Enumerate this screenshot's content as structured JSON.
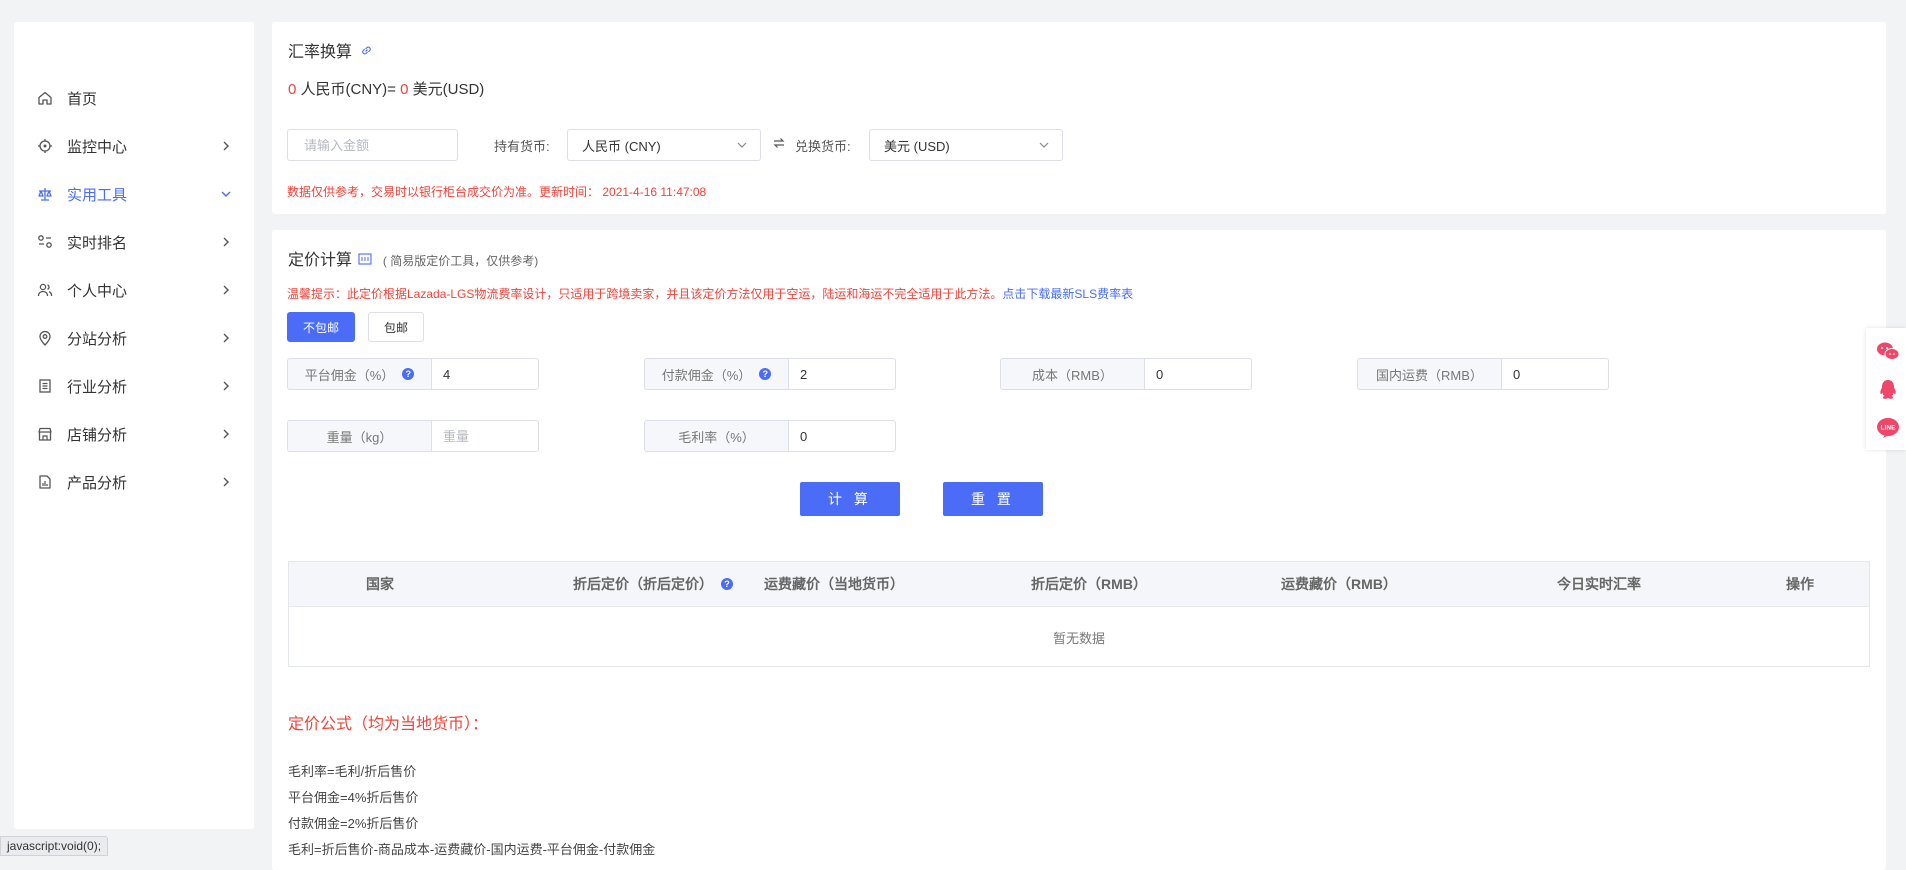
{
  "sidebar": {
    "items": [
      {
        "label": "首页",
        "icon": "home-icon",
        "active": false,
        "chevron": "none"
      },
      {
        "label": "监控中心",
        "icon": "monitor-target-icon",
        "active": false,
        "chevron": "right"
      },
      {
        "label": "实用工具",
        "icon": "balance-scale-icon",
        "active": true,
        "chevron": "down"
      },
      {
        "label": "实时排名",
        "icon": "ranking-icon",
        "active": false,
        "chevron": "right"
      },
      {
        "label": "个人中心",
        "icon": "users-icon",
        "active": false,
        "chevron": "right"
      },
      {
        "label": "分站分析",
        "icon": "location-pin-icon",
        "active": false,
        "chevron": "right"
      },
      {
        "label": "行业分析",
        "icon": "document-list-icon",
        "active": false,
        "chevron": "right"
      },
      {
        "label": "店铺分析",
        "icon": "store-icon",
        "active": false,
        "chevron": "right"
      },
      {
        "label": "产品分析",
        "icon": "product-chart-icon",
        "active": false,
        "chevron": "right"
      }
    ]
  },
  "exchange": {
    "title": "汇率换算",
    "result_amount_cny": "0",
    "result_cny_label": "人民币(CNY)=",
    "result_amount_usd": "0",
    "result_usd_label": "美元(USD)",
    "amount_placeholder": "请输入金额",
    "hold_label": "持有货币:",
    "hold_value": "人民币 (CNY)",
    "target_label": "兑换货币:",
    "target_value": "美元 (USD)",
    "notice": "数据仅供参考，交易时以银行柜台成交价为准。更新时间：",
    "updated_at": "2021-4-16 11:47:08"
  },
  "pricing": {
    "title": "定价计算",
    "subtitle": "( 简易版定价工具，仅供参考)",
    "tip_prefix": "温馨提示：此定价根据Lazada-LGS物流费率设计，只适用于跨境卖家，并且该定价方法仅用于空运，陆运和海运不完全适用于此方法。",
    "tip_link": "点击下载最新SLS费率表",
    "tab_no_shipping": "不包邮",
    "tab_shipping": "包邮",
    "fields": {
      "platform_commission_label": "平台佣金（%）",
      "platform_commission_value": "4",
      "payment_commission_label": "付款佣金（%）",
      "payment_commission_value": "2",
      "cost_label": "成本（RMB）",
      "cost_value": "0",
      "domestic_shipping_label": "国内运费（RMB）",
      "domestic_shipping_value": "0",
      "weight_label": "重量（kg）",
      "weight_placeholder": "重量",
      "gross_margin_label": "毛利率（%）",
      "gross_margin_value": "0"
    },
    "calc_button": "计 算",
    "reset_button": "重 置",
    "table": {
      "headers": [
        "国家",
        "折后定价（折后定价）",
        "运费藏价（当地货币）",
        "折后定价（RMB）",
        "运费藏价（RMB）",
        "今日实时汇率",
        "操作"
      ],
      "empty_text": "暂无数据"
    },
    "formula_title": "定价公式（均为当地货币）：",
    "formulas": [
      "毛利率=毛利/折后售价",
      "平台佣金=4%折后售价",
      "付款佣金=2%折后售价",
      "毛利=折后售价-商品成本-运费藏价-国内运费-平台佣金-付款佣金"
    ]
  },
  "status_bar_text": "javascript:void(0);",
  "float_icons": [
    "wechat-icon",
    "qq-icon",
    "line-icon"
  ],
  "colors": {
    "accent": "#4a6cf7",
    "danger": "#f0433a"
  }
}
